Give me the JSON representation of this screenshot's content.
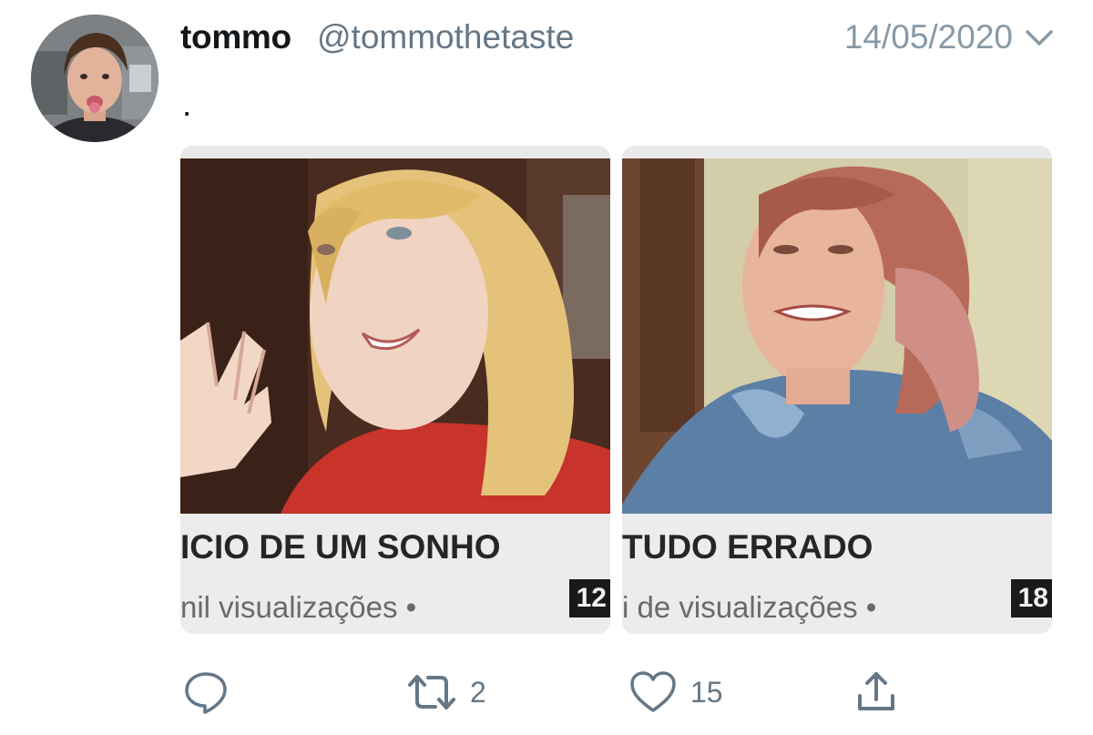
{
  "tweet": {
    "author_name": "tommo",
    "author_handle": "@tommothetaste",
    "date": "14/05/2020",
    "text": ".",
    "icons": {
      "menu": "chevron-down-icon",
      "reply": "reply-icon",
      "retweet": "retweet-icon",
      "like": "heart-icon",
      "share": "share-icon"
    },
    "colors": {
      "primary_text": "#14171a",
      "secondary_text": "#657786",
      "icon": "#657786"
    }
  },
  "media": [
    {
      "title": "ICIO DE UM SONHO",
      "views": "nil visualizações •",
      "duration": "12"
    },
    {
      "title": "TUDO ERRADO",
      "views": "i de visualizações •",
      "duration": "18"
    }
  ],
  "actions": {
    "retweets": "2",
    "likes": "15"
  }
}
